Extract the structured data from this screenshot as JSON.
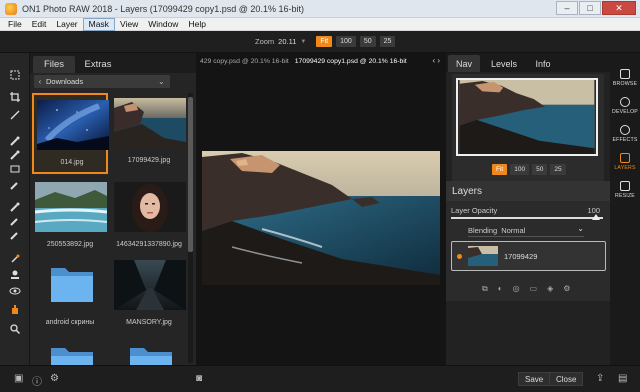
{
  "window": {
    "title": "ON1 Photo RAW 2018 - Layers (17099429 copy1.psd @ 20.1% 16-bit)",
    "minimize": "–",
    "maximize": "□",
    "close": "✕"
  },
  "menu": {
    "items": [
      "File",
      "Edit",
      "Layer",
      "Mask",
      "View",
      "Window",
      "Help"
    ],
    "active": "Mask"
  },
  "zoom": {
    "label": "Zoom",
    "value": "20.11",
    "presets": [
      "Fit",
      "100",
      "50",
      "25"
    ],
    "active": "Fit"
  },
  "browser": {
    "tabs": [
      "Files",
      "Extras"
    ],
    "active_tab": "Files",
    "folder": "Downloads",
    "thumbnails": [
      {
        "label": "014.jpg",
        "selected": true
      },
      {
        "label": "17099429.jpg",
        "selected": false
      },
      {
        "label": "250553892.jpg",
        "selected": false
      },
      {
        "label": "1463429133789​0.jpg",
        "selected": false
      },
      {
        "label": "android скрины",
        "selected": false
      },
      {
        "label": "MANSORY.jpg",
        "selected": false
      }
    ]
  },
  "document_tabs": {
    "items": [
      "429 copy.psd @ 20.1% 16-bit",
      "17099429 copy1.psd @ 20.1% 16-bit"
    ],
    "active": "17099429 copy1.psd @ 20.1% 16-bit"
  },
  "right_panel": {
    "tabs": [
      "Nav",
      "Levels",
      "Info"
    ],
    "active_tab": "Nav",
    "nav_zoom": [
      "Fit",
      "100",
      "50",
      "25"
    ],
    "nav_zoom_active": "Fit",
    "layers": {
      "title": "Layers",
      "opacity_label": "Layer Opacity",
      "opacity_value": "100",
      "opacity_fraction": 1.0,
      "blend_label": "Blending",
      "blend_value": "Normal",
      "layer_name": "17099429"
    }
  },
  "modules": [
    {
      "label": "BROWSE",
      "active": false
    },
    {
      "label": "DEVELOP",
      "active": false
    },
    {
      "label": "EFFECTS",
      "active": false
    },
    {
      "label": "LAYERS",
      "active": true
    },
    {
      "label": "RESIZE",
      "active": false
    }
  ],
  "bottom": {
    "save": "Save",
    "close": "Close"
  },
  "colors": {
    "accent": "#f1881c",
    "panel": "#252525",
    "canvas": "#141414"
  }
}
